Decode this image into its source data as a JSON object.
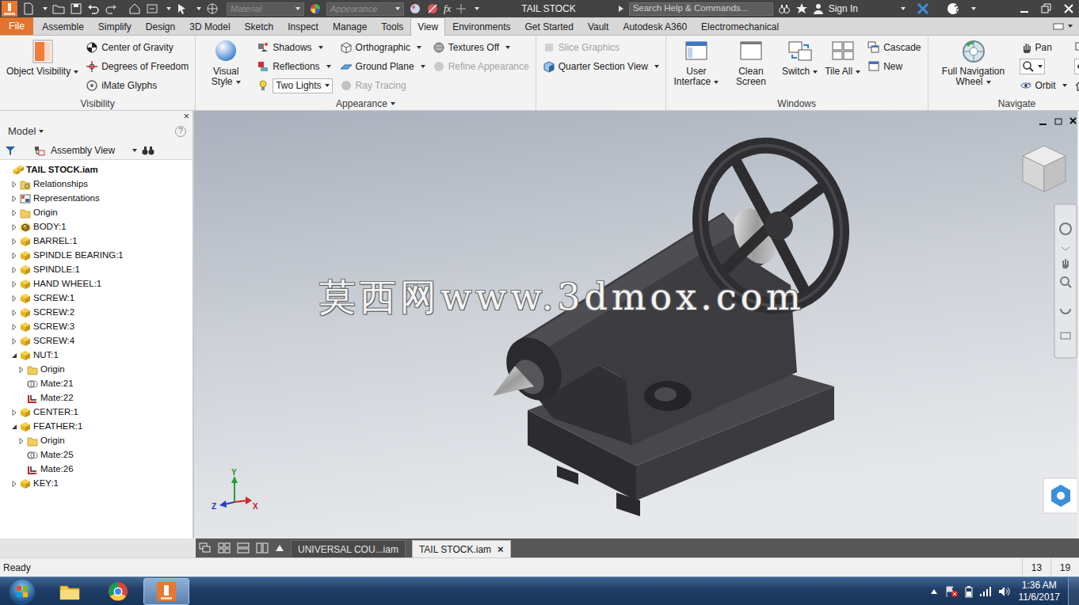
{
  "window": {
    "title": "TAIL STOCK"
  },
  "quick_access": {
    "material": "Material",
    "appearance": "Appearance",
    "function": "fx"
  },
  "search": {
    "placeholder": "Search Help & Commands..."
  },
  "account": {
    "sign_in": "Sign In"
  },
  "help": {
    "label": "?"
  },
  "file_menu": {
    "label": "File"
  },
  "ribbon_tabs": [
    {
      "label": "Assemble",
      "selected": false
    },
    {
      "label": "Simplify",
      "selected": false
    },
    {
      "label": "Design",
      "selected": false
    },
    {
      "label": "3D Model",
      "selected": false
    },
    {
      "label": "Sketch",
      "selected": false
    },
    {
      "label": "Inspect",
      "selected": false
    },
    {
      "label": "Manage",
      "selected": false
    },
    {
      "label": "Tools",
      "selected": false
    },
    {
      "label": "View",
      "selected": true
    },
    {
      "label": "Environments",
      "selected": false
    },
    {
      "label": "Get Started",
      "selected": false
    },
    {
      "label": "Vault",
      "selected": false
    },
    {
      "label": "Autodesk A360",
      "selected": false
    },
    {
      "label": "Electromechanical",
      "selected": false
    }
  ],
  "ribbon_groups": [
    {
      "title": "Visibility",
      "dropdown": false,
      "items": [
        {
          "label": "Object Visibility",
          "kind": "large",
          "dropdown": true,
          "disabled": false
        },
        {
          "label": "Center of Gravity",
          "kind": "small",
          "dropdown": false,
          "disabled": false
        },
        {
          "label": "Degrees of Freedom",
          "kind": "small",
          "dropdown": false,
          "disabled": false
        },
        {
          "label": "iMate Glyphs",
          "kind": "small",
          "dropdown": false,
          "disabled": false
        }
      ]
    },
    {
      "title": "Appearance",
      "dropdown": true,
      "items": [
        {
          "label": "Visual Style",
          "kind": "large",
          "dropdown": true,
          "disabled": false
        },
        {
          "label": "Shadows",
          "kind": "small",
          "dropdown": true,
          "disabled": false
        },
        {
          "label": "Reflections",
          "kind": "small",
          "dropdown": true,
          "disabled": false
        },
        {
          "label": "Two Lights",
          "kind": "combo",
          "dropdown": true,
          "disabled": false
        },
        {
          "label": "Orthographic",
          "kind": "small",
          "dropdown": true,
          "disabled": false
        },
        {
          "label": "Ground Plane",
          "kind": "small",
          "dropdown": true,
          "disabled": false
        },
        {
          "label": "Ray Tracing",
          "kind": "small",
          "dropdown": false,
          "disabled": true
        },
        {
          "label": "Textures Off",
          "kind": "small",
          "dropdown": true,
          "disabled": false
        },
        {
          "label": "Refine Appearance",
          "kind": "small",
          "dropdown": false,
          "disabled": true
        }
      ]
    },
    {
      "items": [
        {
          "label": "Slice Graphics",
          "kind": "small",
          "dropdown": false,
          "disabled": true
        },
        {
          "label": "Quarter Section View",
          "kind": "small",
          "dropdown": true,
          "disabled": false
        }
      ]
    },
    {
      "title": "Windows",
      "dropdown": false,
      "items": [
        {
          "label": "User Interface",
          "kind": "large",
          "dropdown": true,
          "disabled": false
        },
        {
          "label": "Clean Screen",
          "kind": "large",
          "dropdown": false,
          "disabled": false
        },
        {
          "label": "Switch",
          "kind": "large",
          "dropdown": true,
          "disabled": false
        },
        {
          "label": "Tile All",
          "kind": "large",
          "dropdown": true,
          "disabled": false
        },
        {
          "label": "Cascade",
          "kind": "small",
          "dropdown": false,
          "disabled": false
        },
        {
          "label": "New",
          "kind": "small",
          "dropdown": false,
          "disabled": false
        }
      ]
    },
    {
      "title": "Navigate",
      "dropdown": false,
      "items": [
        {
          "label": "Full Navigation Wheel",
          "kind": "large",
          "dropdown": true,
          "disabled": false
        },
        {
          "label": "Pan",
          "kind": "small",
          "dropdown": false,
          "disabled": false
        },
        {
          "kind": "icon",
          "dropdown": true,
          "disabled": false
        },
        {
          "label": "Orbit",
          "kind": "small",
          "dropdown": true,
          "disabled": false
        },
        {
          "kind": "icon",
          "dropdown": false,
          "disabled": false
        },
        {
          "kind": "icon",
          "dropdown": true,
          "disabled": false
        },
        {
          "kind": "icon",
          "dropdown": false,
          "disabled": false
        }
      ]
    }
  ],
  "browser": {
    "close": "×",
    "title": "Model",
    "help": "?",
    "view": "Assembly View",
    "items": [
      {
        "label": "TAIL STOCK.iam",
        "depth": 0,
        "kind": "assembly"
      },
      {
        "label": "Relationships",
        "depth": 1,
        "kind": "relationships",
        "expanded": false
      },
      {
        "label": "Representations",
        "depth": 1,
        "kind": "representations",
        "expanded": false
      },
      {
        "label": "Origin",
        "depth": 1,
        "kind": "folder",
        "expanded": false
      },
      {
        "label": "BODY:1",
        "depth": 1,
        "kind": "grounded-part",
        "expanded": false
      },
      {
        "label": "BARREL:1",
        "depth": 1,
        "kind": "part",
        "expanded": false
      },
      {
        "label": "SPINDLE BEARING:1",
        "depth": 1,
        "kind": "part",
        "expanded": false
      },
      {
        "label": "SPINDLE:1",
        "depth": 1,
        "kind": "part",
        "expanded": false
      },
      {
        "label": "HAND WHEEL:1",
        "depth": 1,
        "kind": "part",
        "expanded": false
      },
      {
        "label": "SCREW:1",
        "depth": 1,
        "kind": "part",
        "expanded": false
      },
      {
        "label": "SCREW:2",
        "depth": 1,
        "kind": "part",
        "expanded": false
      },
      {
        "label": "SCREW:3",
        "depth": 1,
        "kind": "part",
        "expanded": false
      },
      {
        "label": "SCREW:4",
        "depth": 1,
        "kind": "part",
        "expanded": false
      },
      {
        "label": "NUT:1",
        "depth": 1,
        "kind": "part",
        "expanded": true
      },
      {
        "label": "Origin",
        "depth": 2,
        "kind": "folder",
        "expanded": false
      },
      {
        "label": "Mate:21",
        "depth": 2,
        "kind": "mate"
      },
      {
        "label": "Mate:22",
        "depth": 2,
        "kind": "flush"
      },
      {
        "label": "CENTER:1",
        "depth": 1,
        "kind": "part",
        "expanded": false
      },
      {
        "label": "FEATHER:1",
        "depth": 1,
        "kind": "part",
        "expanded": true
      },
      {
        "label": "Origin",
        "depth": 2,
        "kind": "folder",
        "expanded": false
      },
      {
        "label": "Mate:25",
        "depth": 2,
        "kind": "mate"
      },
      {
        "label": "Mate:26",
        "depth": 2,
        "kind": "flush"
      },
      {
        "label": "KEY:1",
        "depth": 1,
        "kind": "part",
        "expanded": false
      }
    ]
  },
  "viewport": {
    "watermark": "莫西网www.3dmox.com",
    "axes": {
      "y": "Y",
      "z": "Z",
      "x": "X"
    }
  },
  "document_tabs": [
    {
      "label": "UNIVERSAL COU...iam",
      "selected": false
    },
    {
      "label": "TAIL STOCK.iam",
      "selected": true,
      "close": "×"
    }
  ],
  "status_bar": {
    "message": "Ready",
    "fields": [
      "13",
      "19"
    ]
  },
  "taskbar": {
    "apps": [
      {
        "kind": "explorer",
        "selected": false
      },
      {
        "kind": "chrome",
        "selected": false
      },
      {
        "kind": "inventor",
        "selected": true
      }
    ],
    "time": "1:36 AM",
    "date": "11/6/2017"
  }
}
